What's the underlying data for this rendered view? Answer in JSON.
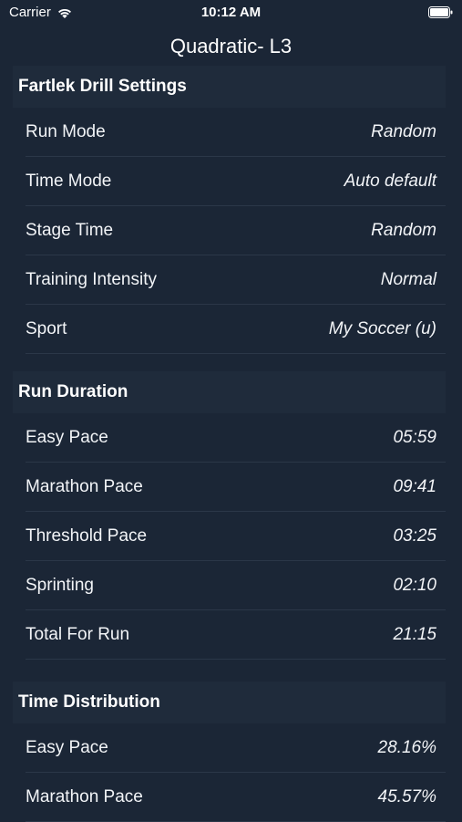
{
  "status_bar": {
    "carrier": "Carrier",
    "time": "10:12 AM"
  },
  "nav": {
    "title": "Quadratic- L3"
  },
  "sections": [
    {
      "header": "Fartlek Drill Settings",
      "rows": [
        {
          "label": "Run Mode",
          "value": "Random"
        },
        {
          "label": "Time Mode",
          "value": "Auto default"
        },
        {
          "label": "Stage Time",
          "value": "Random"
        },
        {
          "label": "Training Intensity",
          "value": "Normal"
        },
        {
          "label": "Sport",
          "value": "My Soccer (u)"
        }
      ]
    },
    {
      "header": "Run Duration",
      "rows": [
        {
          "label": "Easy Pace",
          "value": "05:59"
        },
        {
          "label": "Marathon Pace",
          "value": "09:41"
        },
        {
          "label": "Threshold Pace",
          "value": "03:25"
        },
        {
          "label": "Sprinting",
          "value": "02:10"
        },
        {
          "label": "Total For Run",
          "value": "21:15"
        }
      ]
    },
    {
      "header": "Time Distribution",
      "rows": [
        {
          "label": "Easy Pace",
          "value": "28.16%"
        },
        {
          "label": "Marathon Pace",
          "value": "45.57%"
        }
      ]
    }
  ]
}
